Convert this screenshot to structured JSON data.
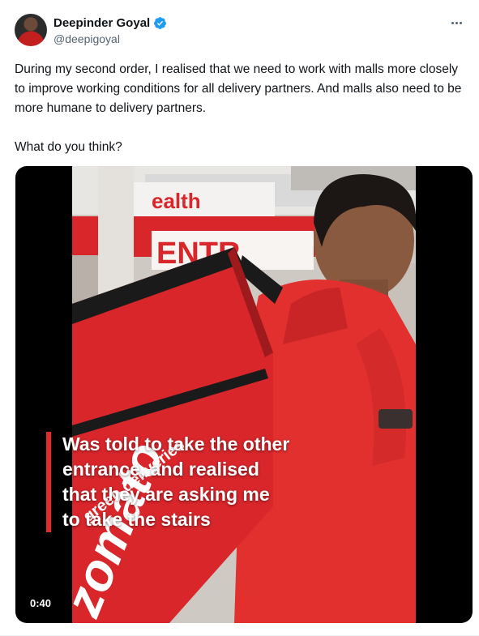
{
  "author": {
    "name": "Deepinder Goyal",
    "handle": "@deepigoyal",
    "verified": true
  },
  "tweet": {
    "paragraphs": [
      "During my second order, I realised that we need to work with malls more closely to improve working conditions for all delivery partners. And malls also need to be more humane to delivery partners.",
      "What do you think?"
    ]
  },
  "video": {
    "duration": "0:40",
    "scene_text": {
      "sign_top": "ealth",
      "sign_entry": "ENTR",
      "bag_text": "green deliveries",
      "bag_brand": "zomato"
    },
    "caption_lines": [
      "Was told to take the other",
      "entrance, and realised",
      "that they are asking me",
      "to take the stairs"
    ]
  },
  "icons": {
    "verified": "verified-badge-icon",
    "more": "more-options-icon",
    "avatar": "profile-avatar"
  },
  "colors": {
    "verified_blue": "#1d9bf0",
    "caption_bar": "#e22a2a",
    "bag_red": "#d8262b"
  }
}
